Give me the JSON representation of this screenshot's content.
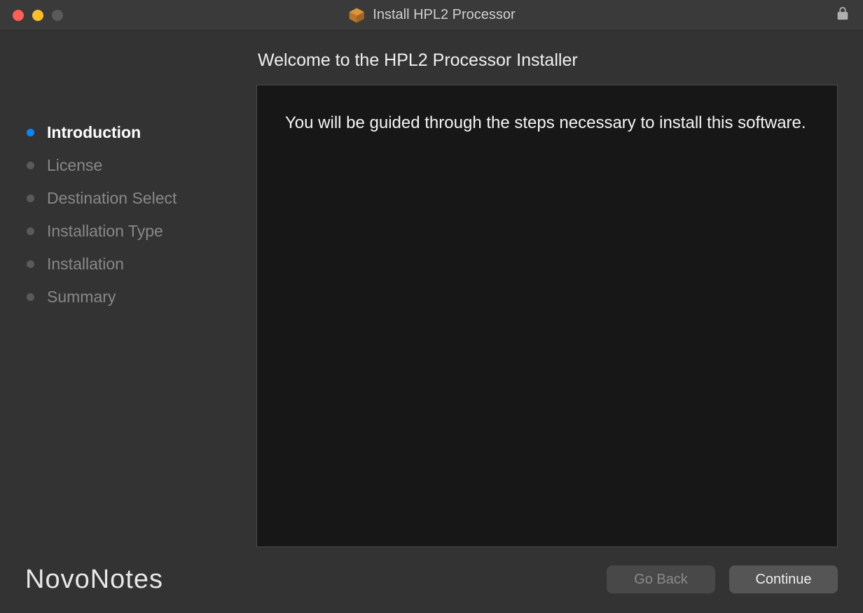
{
  "titlebar": {
    "title": "Install HPL2 Processor"
  },
  "sidebar": {
    "steps": [
      {
        "label": "Introduction",
        "active": true
      },
      {
        "label": "License",
        "active": false
      },
      {
        "label": "Destination Select",
        "active": false
      },
      {
        "label": "Installation Type",
        "active": false
      },
      {
        "label": "Installation",
        "active": false
      },
      {
        "label": "Summary",
        "active": false
      }
    ]
  },
  "main": {
    "heading": "Welcome to the HPL2 Processor Installer",
    "body_text": "You will be guided through the steps necessary to install this software."
  },
  "footer": {
    "brand": "NovoNotes",
    "go_back_label": "Go Back",
    "continue_label": "Continue"
  }
}
